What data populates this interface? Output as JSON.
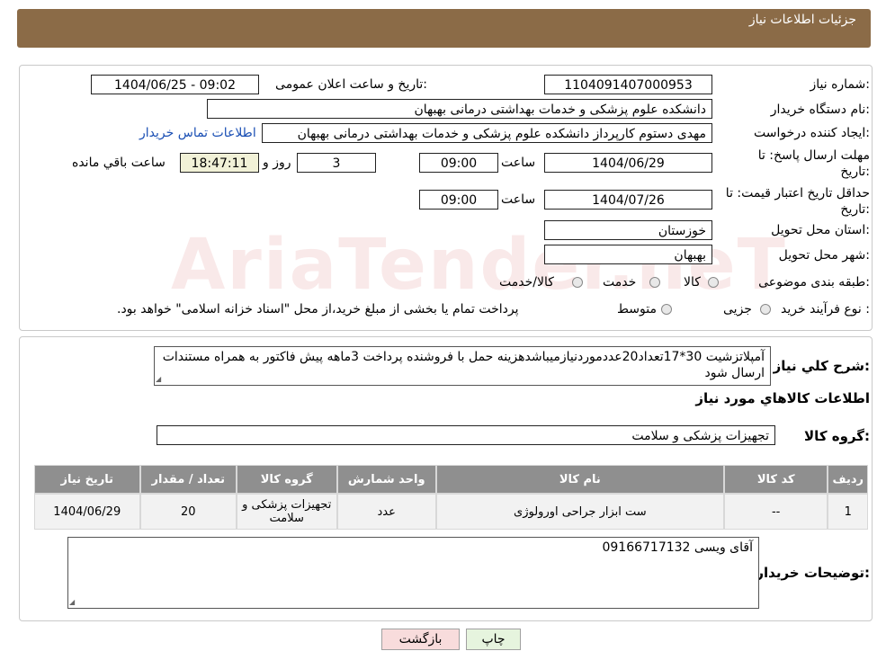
{
  "header": {
    "title": "جزئیات اطلاعات نیاز"
  },
  "form": {
    "need_number_label": "شماره نیاز:",
    "need_number": "1104091407000953",
    "announce_label": "تاریخ و ساعت اعلان عمومی:",
    "announce_value": "1404/06/25 - 09:02",
    "buyer_org_label": "نام دستگاه خریدار:",
    "buyer_org": "دانشکده علوم پزشکی و خدمات بهداشتی  درمانی بهبهان",
    "creator_label": "ایجاد کننده درخواست:",
    "creator": "مهدی دستوم کارپرداز دانشکده علوم پزشکی و خدمات بهداشتی  درمانی بهبهان",
    "contact_link": "اطلاعات تماس خریدار",
    "deadline_label": "مهلت ارسال پاسخ: تا تاریخ:",
    "deadline_date": "1404/06/29",
    "time_label": "ساعت",
    "deadline_time": "09:00",
    "days_value": "3",
    "days_label": "روز و",
    "remaining_time": "18:47:11",
    "remaining_label": "ساعت باقي مانده",
    "validity_label": "حداقل تاریخ اعتبار قیمت: تا تاریخ:",
    "validity_date": "1404/07/26",
    "validity_time": "09:00",
    "province_label": "استان محل تحویل:",
    "province": "خوزستان",
    "city_label": "شهر محل تحویل:",
    "city": "بهبهان",
    "category_label": "طبقه بندی موضوعی:",
    "category_options": [
      "کالا",
      "خدمت",
      "کالا/خدمت"
    ],
    "process_label": "نوع فرآیند خرید :",
    "process_options": [
      "جزیی",
      "متوسط"
    ],
    "process_note": "پرداخت تمام یا بخشی از مبلغ خرید،از محل \"اسناد خزانه اسلامی\" خواهد بود."
  },
  "description": {
    "label": "شرح کلي نياز:",
    "text": "آمپلاتزشیت 30*17تعداد20عددموردنیازمیباشدهزینه حمل با فروشنده پرداخت 3ماهه پیش فاکتور به همراه مستندات ارسال شود"
  },
  "goods": {
    "section_title": "اطلاعات کالاهاي مورد نياز",
    "group_label": "گروه کالا:",
    "group_value": "تجهیزات پزشکی و سلامت",
    "columns": [
      "ردیف",
      "کد کالا",
      "نام کالا",
      "واحد شمارش",
      "گروه کالا",
      "تعداد / مقدار",
      "تاریخ نیاز"
    ],
    "rows": [
      [
        "1",
        "--",
        "ست ابزار جراحی اورولوژی",
        "عدد",
        "تجهیزات پزشکی و سلامت",
        "20",
        "1404/06/29"
      ]
    ]
  },
  "buyer_notes": {
    "label": "توضیحات خریدار:",
    "text": "آقای ویسی 09166717132"
  },
  "buttons": {
    "print": "چاپ",
    "back": "بازگشت"
  }
}
